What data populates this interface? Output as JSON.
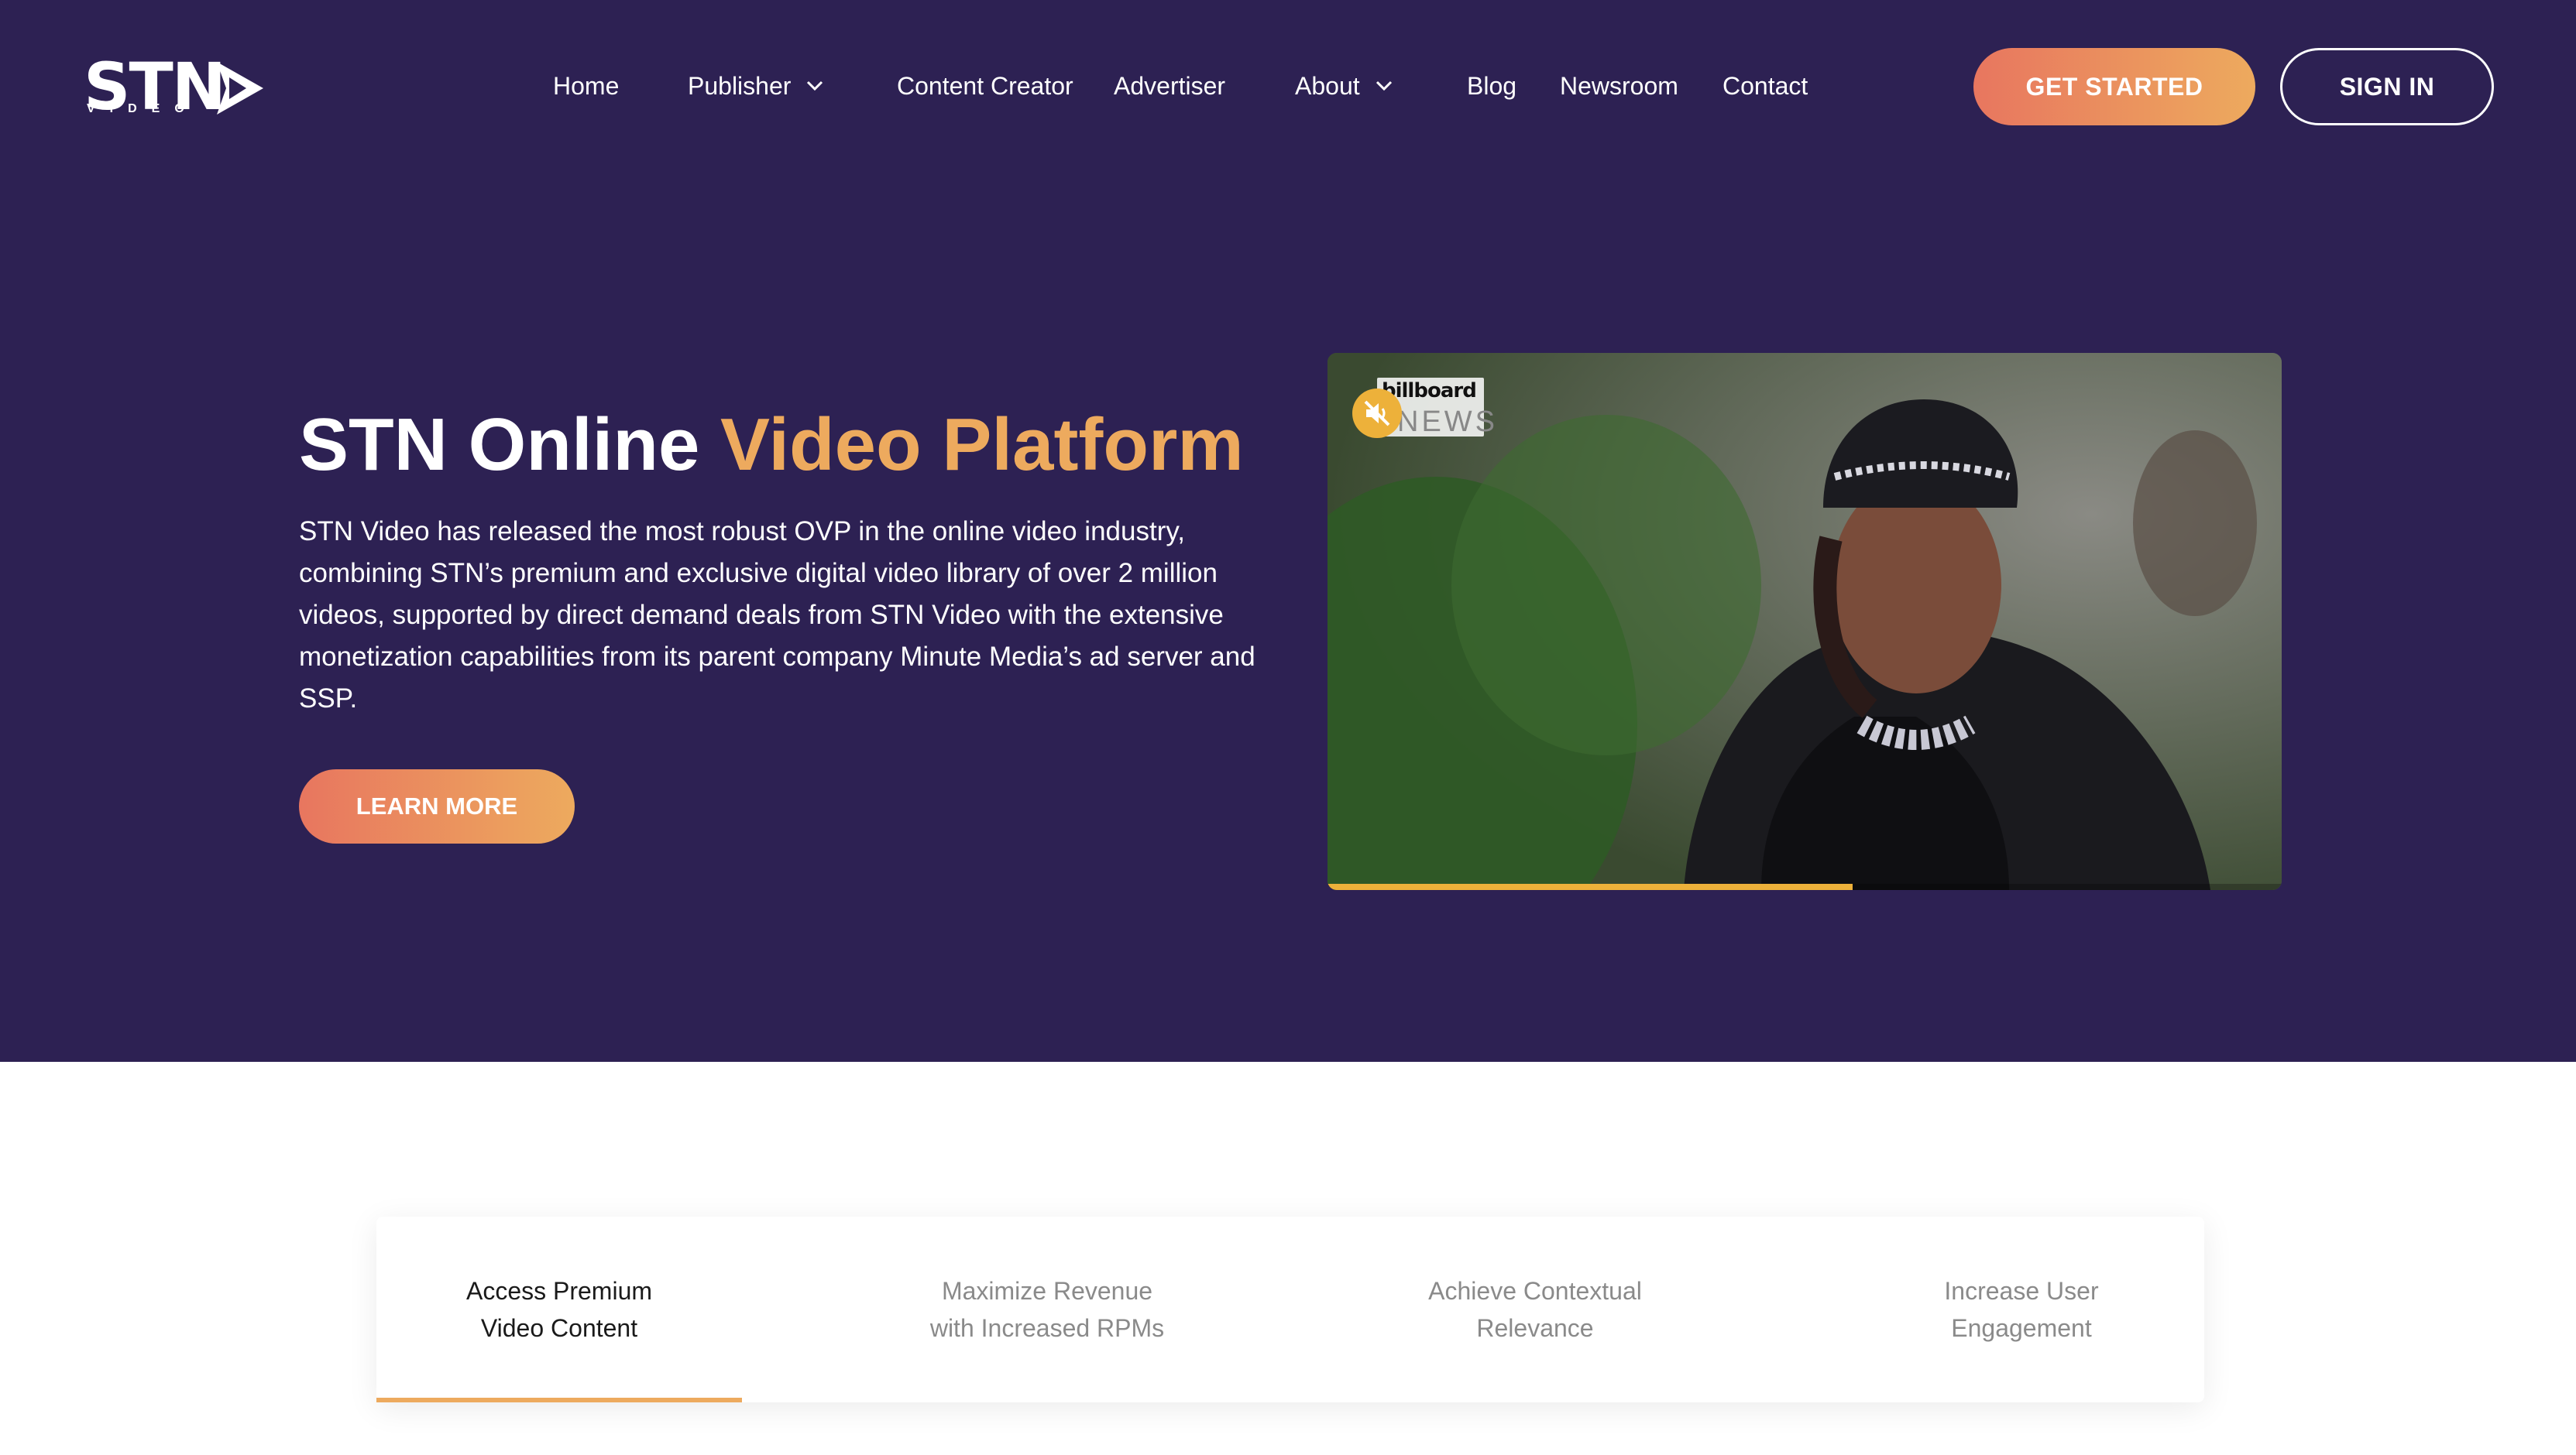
{
  "header": {
    "logo_text": "STN",
    "logo_sub": "VIDEO",
    "nav": [
      {
        "label": "Home",
        "dropdown": false
      },
      {
        "label": "Publisher",
        "dropdown": true
      },
      {
        "label": "Content Creator",
        "dropdown": false
      },
      {
        "label": "Advertiser",
        "dropdown": false
      },
      {
        "label": "About",
        "dropdown": true
      },
      {
        "label": "Blog",
        "dropdown": false
      },
      {
        "label": "Newsroom",
        "dropdown": false
      },
      {
        "label": "Contact",
        "dropdown": false
      }
    ],
    "get_started_label": "GET STARTED",
    "sign_in_label": "SIGN IN"
  },
  "hero": {
    "title_main": "STN Online ",
    "title_accent": "Video Platform",
    "description": "STN Video has released the most robust OVP in the online video industry, combining STN’s premium and exclusive digital video library of over 2 million videos, supported by direct demand deals from STN Video with the extensive monetization capabilities from its parent company Minute Media’s ad server and SSP.",
    "learn_more_label": "LEARN MORE"
  },
  "video": {
    "brand_top": "billboard",
    "brand_bottom": "NEWS",
    "progress_fraction": 0.55,
    "muted": true
  },
  "tabs": [
    {
      "label": "Access Premium\nVideo Content",
      "active": true
    },
    {
      "label": "Maximize Revenue\nwith Increased RPMs",
      "active": false
    },
    {
      "label": "Achieve Contextual\nRelevance",
      "active": false
    },
    {
      "label": "Increase User\nEngagement",
      "active": false
    }
  ],
  "colors": {
    "hero_bg": "#2d2153",
    "accent": "#edaa5e",
    "gradient_start": "#e8765f",
    "video_progress": "#edb13a"
  }
}
